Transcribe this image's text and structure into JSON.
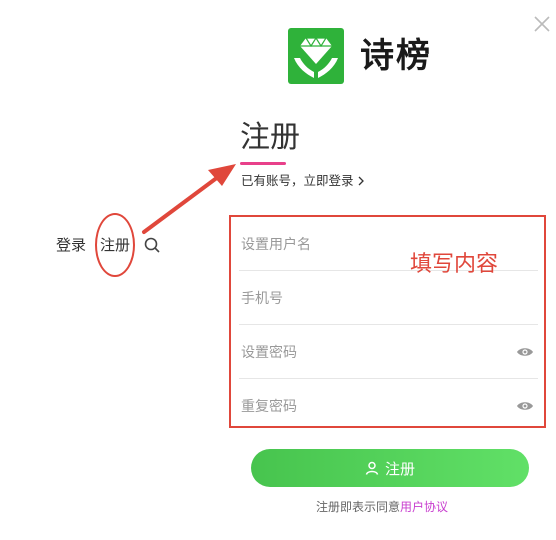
{
  "brand": {
    "name": "诗榜",
    "color": "#2fb23a"
  },
  "page": {
    "title": "注册",
    "accent": "#e8408a",
    "login_link": "已有账号，立即登录"
  },
  "side_nav": {
    "login": "登录",
    "register": "注册",
    "search_icon": "search-icon"
  },
  "form": {
    "fields": [
      {
        "placeholder": "设置用户名",
        "value": ""
      },
      {
        "placeholder": "手机号",
        "value": ""
      },
      {
        "placeholder": "设置密码",
        "value": "",
        "icon": "eye-icon"
      },
      {
        "placeholder": "重复密码",
        "value": "",
        "icon": "eye-icon"
      }
    ]
  },
  "annotation": {
    "text": "填写内容",
    "color": "#e0473b"
  },
  "submit": {
    "label": "注册",
    "icon": "user-icon",
    "color": "#4fcf55"
  },
  "agreement": {
    "prefix": "注册即表示同意",
    "link": "用户协议",
    "link_color": "#c83ecf"
  }
}
